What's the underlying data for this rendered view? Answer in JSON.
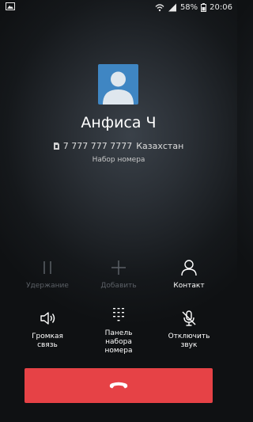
{
  "status_bar": {
    "battery": "58%",
    "time": "20:06",
    "icons": [
      "image-icon",
      "wifi-icon",
      "signal-icon",
      "battery-icon"
    ]
  },
  "contact": {
    "name": "Анфиса Ч",
    "number": "7 777 777 7777",
    "location": "Казахстан",
    "status": "Набор номера"
  },
  "controls": {
    "hold": {
      "label": "Удержание",
      "icon": "pause-icon"
    },
    "add": {
      "label": "Добавить",
      "icon": "plus-icon"
    },
    "contact": {
      "label": "Контакт",
      "icon": "person-icon"
    },
    "speaker": {
      "label_1": "Громкая",
      "label_2": "связь",
      "icon": "speaker-icon"
    },
    "dialpad": {
      "label_1": "Панель",
      "label_2": "набора",
      "label_3": "номера",
      "icon": "dialpad-icon"
    },
    "mute": {
      "label_1": "Отключить",
      "label_2": "звук",
      "icon": "mic-off-icon"
    }
  },
  "end_call": {
    "icon": "phone-hangup-icon",
    "color": "#e64246"
  },
  "colors": {
    "accent": "#3f86c3",
    "disabled": "#5b6066"
  }
}
